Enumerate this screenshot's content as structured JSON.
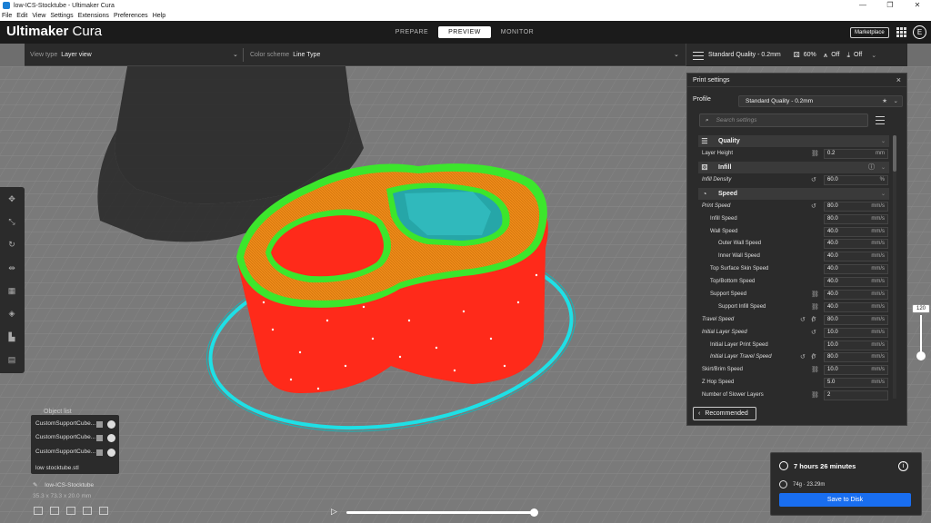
{
  "window": {
    "title": "low-ICS-Stocktube - Ultimaker Cura",
    "controls": [
      "—",
      "❐",
      "✕"
    ]
  },
  "menu": [
    "File",
    "Edit",
    "View",
    "Settings",
    "Extensions",
    "Preferences",
    "Help"
  ],
  "header": {
    "brand_primary": "Ultimaker",
    "brand_secondary": "Cura",
    "tabs": [
      {
        "label": "PREPARE",
        "active": false
      },
      {
        "label": "PREVIEW",
        "active": true
      },
      {
        "label": "MONITOR",
        "active": false
      }
    ],
    "marketplace_label": "Marketplace",
    "avatar_initial": "E"
  },
  "viewbar": {
    "view_type_label": "View type",
    "view_type_value": "Layer view",
    "color_scheme_label": "Color scheme",
    "color_scheme_value": "Line Type"
  },
  "setupbar": {
    "profile": "Standard Quality - 0.2mm",
    "infill": "60%",
    "support": "Off",
    "adhesion": "Off"
  },
  "panel": {
    "title": "Print settings",
    "close": "×",
    "profile_label": "Profile",
    "profile_value": "Standard Quality - 0.2mm",
    "search_placeholder": "Search settings",
    "recommended_label": "Recommended"
  },
  "settings": {
    "quality_title": "Quality",
    "layer_height": {
      "label": "Layer Height",
      "value": "0.2",
      "unit": "mm"
    },
    "infill_title": "Infill",
    "infill_density": {
      "label": "Infill Density",
      "value": "60.0",
      "unit": "%"
    },
    "speed_title": "Speed",
    "rows": [
      {
        "label": "Print Speed",
        "value": "80.0",
        "unit": "mm/s",
        "indent": 0,
        "italic": true
      },
      {
        "label": "Infill Speed",
        "value": "80.0",
        "unit": "mm/s",
        "indent": 1,
        "italic": false
      },
      {
        "label": "Wall Speed",
        "value": "40.0",
        "unit": "mm/s",
        "indent": 1,
        "italic": false
      },
      {
        "label": "Outer Wall Speed",
        "value": "40.0",
        "unit": "mm/s",
        "indent": 2,
        "italic": false
      },
      {
        "label": "Inner Wall Speed",
        "value": "40.0",
        "unit": "mm/s",
        "indent": 2,
        "italic": false
      },
      {
        "label": "Top Surface Skin Speed",
        "value": "40.0",
        "unit": "mm/s",
        "indent": 1,
        "italic": false
      },
      {
        "label": "Top/Bottom Speed",
        "value": "40.0",
        "unit": "mm/s",
        "indent": 1,
        "italic": false
      },
      {
        "label": "Support Speed",
        "value": "40.0",
        "unit": "mm/s",
        "indent": 1,
        "italic": false
      },
      {
        "label": "Support Infill Speed",
        "value": "40.0",
        "unit": "mm/s",
        "indent": 2,
        "italic": false
      },
      {
        "label": "Travel Speed",
        "value": "80.0",
        "unit": "mm/s",
        "indent": 0,
        "italic": true
      },
      {
        "label": "Initial Layer Speed",
        "value": "10.0",
        "unit": "mm/s",
        "indent": 0,
        "italic": true
      },
      {
        "label": "Initial Layer Print Speed",
        "value": "10.0",
        "unit": "mm/s",
        "indent": 1,
        "italic": false
      },
      {
        "label": "Initial Layer Travel Speed",
        "value": "80.0",
        "unit": "mm/s",
        "indent": 1,
        "italic": true
      },
      {
        "label": "Skirt/Brim Speed",
        "value": "10.0",
        "unit": "mm/s",
        "indent": 0,
        "italic": false
      },
      {
        "label": "Z Hop Speed",
        "value": "5.0",
        "unit": "mm/s",
        "indent": 0,
        "italic": false
      },
      {
        "label": "Number of Slower Layers",
        "value": "2",
        "unit": "",
        "indent": 0,
        "italic": false
      }
    ]
  },
  "layer_slider": {
    "value": "120"
  },
  "object_list": {
    "title": "Object list",
    "items": [
      "CustomSupportCube...",
      "CustomSupportCube...",
      "CustomSupportCube..."
    ],
    "file": "low stocktube.stl",
    "model_name": "low-ICS-Stocktube",
    "dimensions": "35.3 x 73.3 x 20.0 mm"
  },
  "output": {
    "print_time": "7 hours 26 minutes",
    "material": "74g · 23.29m",
    "save_label": "Save to Disk"
  },
  "colors": {
    "accent": "#196ef0",
    "wall_red": "#ff2a1a",
    "inner_wall_green": "#3ce62c",
    "infill_orange": "#ee8a18",
    "skirt_cyan": "#1ee0e6"
  }
}
